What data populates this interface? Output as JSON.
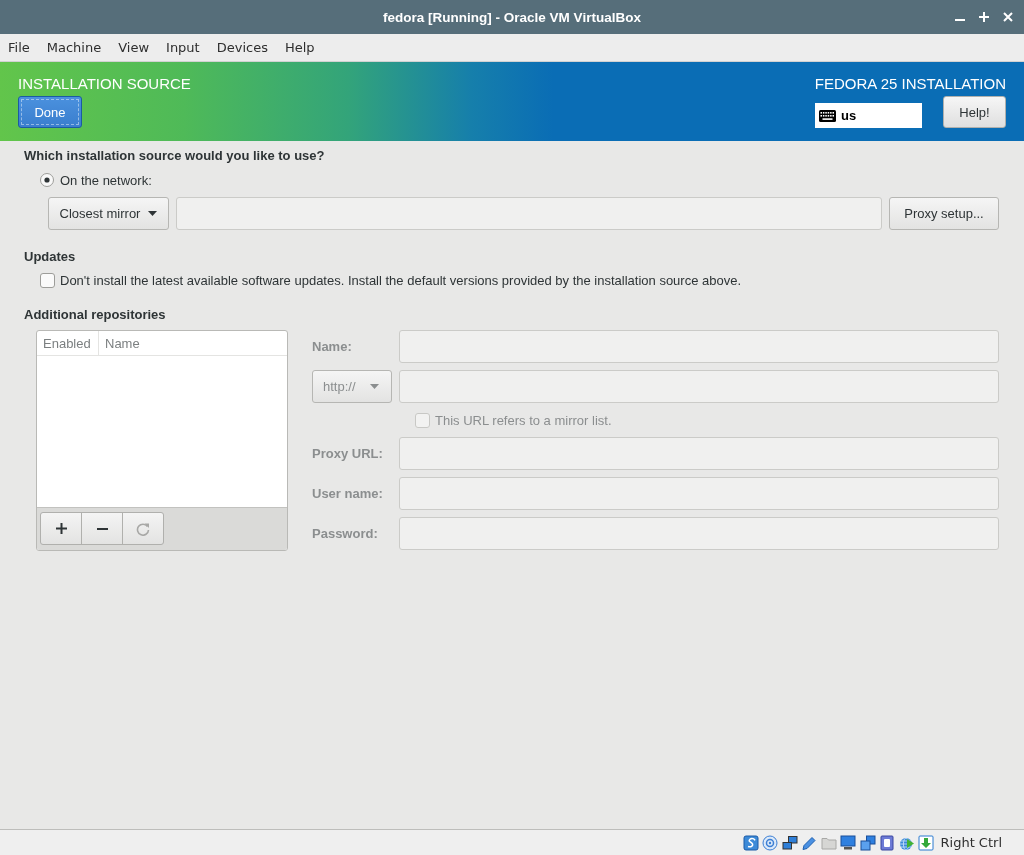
{
  "window": {
    "title": "fedora [Running] - Oracle VM VirtualBox"
  },
  "menu_bar": [
    "File",
    "Machine",
    "View",
    "Input",
    "Devices",
    "Help"
  ],
  "header": {
    "title": "INSTALLATION SOURCE",
    "done_button": "Done",
    "product": "FEDORA 25 INSTALLATION",
    "keyboard_layout": "us",
    "help_button": "Help!"
  },
  "source": {
    "question": "Which installation source would you like to use?",
    "options": [
      {
        "label": "On the network:",
        "selected": true
      }
    ],
    "mirror_dropdown": "Closest mirror",
    "url_field": {
      "disabled": true
    },
    "proxy_button": "Proxy setup..."
  },
  "updates": {
    "heading": "Updates",
    "checkbox": {
      "label": "Don't install the latest available software updates. Install the default versions provided by the installation source above.",
      "checked": false
    }
  },
  "repositories": {
    "heading": "Additional repositories",
    "table": {
      "columns": [
        "Enabled",
        "Name"
      ]
    },
    "toolbar": [
      {
        "kind": "add",
        "disabled": false
      },
      {
        "kind": "remove",
        "disabled": false
      },
      {
        "kind": "refresh",
        "disabled": true
      }
    ],
    "form": {
      "disabled": true,
      "rows": [
        {
          "kind": "text",
          "label": "Name:"
        },
        {
          "kind": "url",
          "protocol": "http://"
        },
        {
          "kind": "checkbox",
          "label": "This URL refers to a mirror list.",
          "checked": false
        },
        {
          "kind": "text",
          "label": "Proxy URL:"
        },
        {
          "kind": "text",
          "label": "User name:"
        },
        {
          "kind": "password",
          "label": "Password:"
        }
      ]
    }
  },
  "status_bar": {
    "host_key": "Right Ctrl"
  }
}
